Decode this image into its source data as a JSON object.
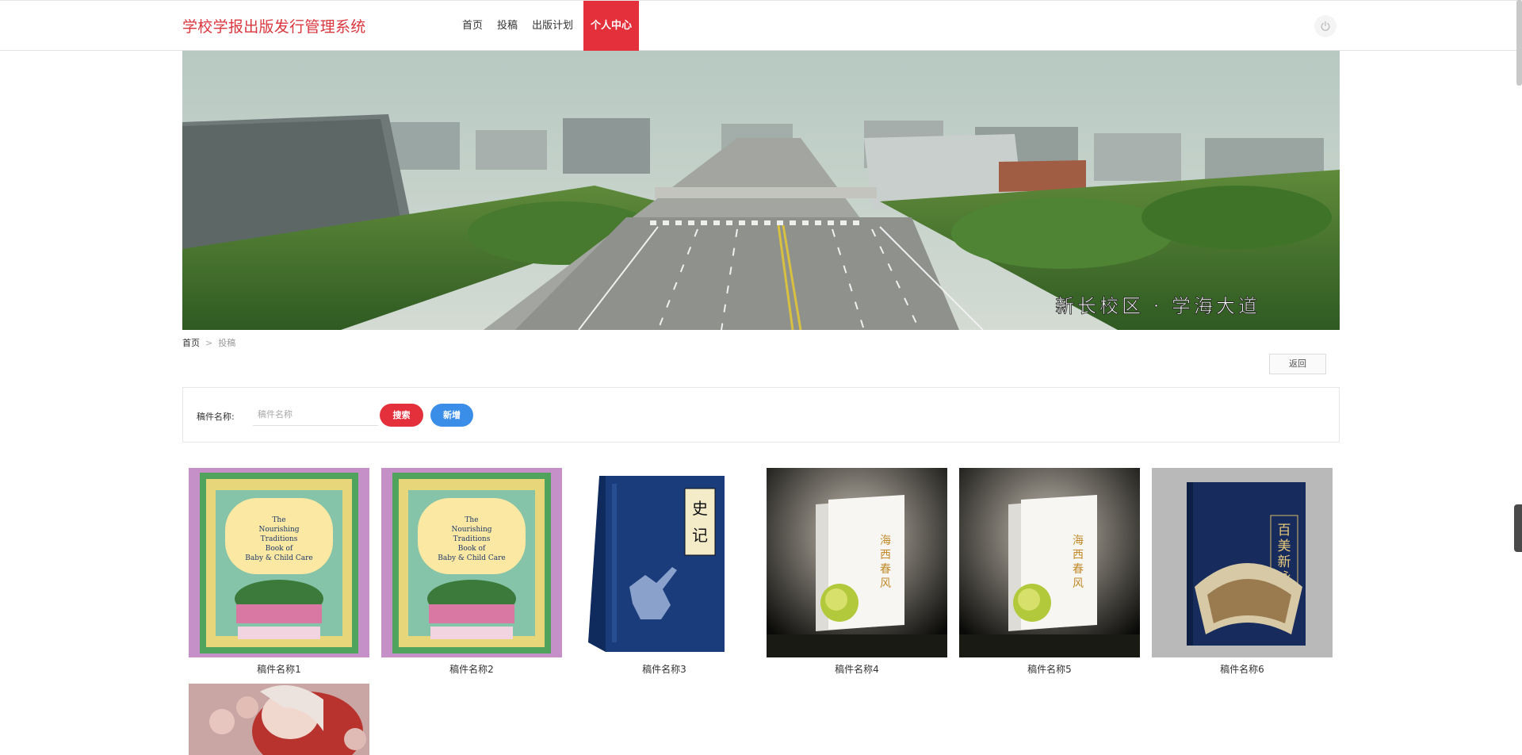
{
  "header": {
    "brand": "学校学报出版发行管理系统",
    "nav": [
      {
        "label": "首页"
      },
      {
        "label": "投稿"
      },
      {
        "label": "出版计划"
      },
      {
        "label": "个人中心",
        "active": true
      }
    ],
    "power_icon": "power-icon"
  },
  "banner": {
    "caption": "新长校区 · 学海大道"
  },
  "breadcrumb": {
    "home": "首页",
    "separator": ">",
    "current": "投稿"
  },
  "actions": {
    "back_label": "返回"
  },
  "search": {
    "label": "稿件名称:",
    "placeholder": "稿件名称",
    "search_label": "搜索",
    "add_label": "新增"
  },
  "manuscripts": [
    {
      "name": "稿件名称1",
      "cover_text": "The Nourishing Traditions Book of Baby & Child Care"
    },
    {
      "name": "稿件名称2",
      "cover_text": "The Nourishing Traditions Book of Baby & Child Care"
    },
    {
      "name": "稿件名称3",
      "cover_text": "史记"
    },
    {
      "name": "稿件名称4",
      "cover_text": "海西春风"
    },
    {
      "name": "稿件名称5",
      "cover_text": "海西春风"
    },
    {
      "name": "稿件名称6",
      "cover_text": "百美新咏"
    },
    {
      "name": "",
      "cover_text": ""
    }
  ],
  "colors": {
    "accent": "#e3303a",
    "primary_blue": "#3b8ee8",
    "brand_text": "#d9363e"
  }
}
